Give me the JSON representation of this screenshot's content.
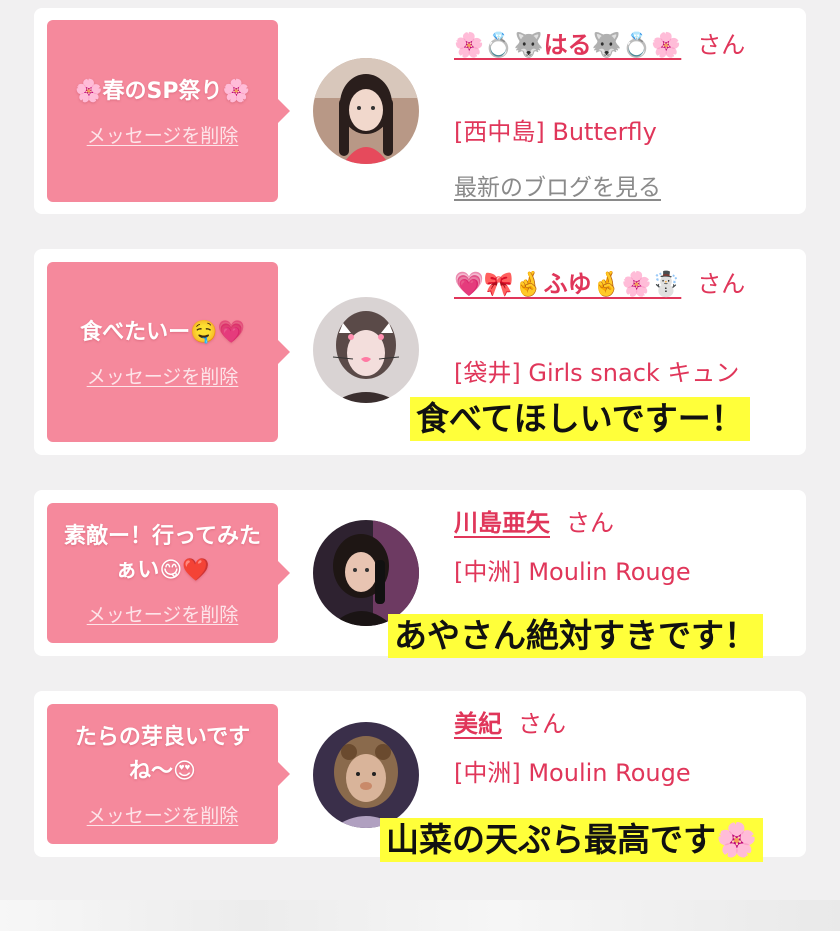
{
  "cards": [
    {
      "message": "🌸春のSP祭り🌸",
      "delete_label": "メッセージを削除",
      "name": "🌸💍🐺はる🐺💍🌸",
      "san": "さん",
      "shop": "[西中島] Butterfly",
      "blog_label": "最新のブログを見る",
      "avatar_icon": "girl-avatar"
    },
    {
      "message": "食べたいー🤤💗",
      "delete_label": "メッセージを削除",
      "name": "💗🎀🤞ふゆ🤞🌸☃️",
      "san": "さん",
      "shop": "[袋井] Girls snack キュン",
      "avatar_icon": "girl-avatar"
    },
    {
      "message": "素敵ー！行ってみたぁい😋❤️",
      "delete_label": "メッセージを削除",
      "name": "川島亜矢",
      "san": "さん",
      "shop": "[中洲] Moulin Rouge",
      "avatar_icon": "girl-avatar"
    },
    {
      "message": "たらの芽良いですね〜😍",
      "delete_label": "メッセージを削除",
      "name": "美紀",
      "san": "さん",
      "shop": "[中洲] Moulin Rouge",
      "avatar_icon": "girl-avatar"
    }
  ],
  "captions": [
    "食べてほしいですー！",
    "あやさん絶対すきです！",
    "山菜の天ぷら最高です🌸"
  ],
  "colors": {
    "accent": "#e0365a",
    "bubble": "#f5899c",
    "caption_bg": "#ffff3a",
    "background": "#f1f0f1"
  }
}
